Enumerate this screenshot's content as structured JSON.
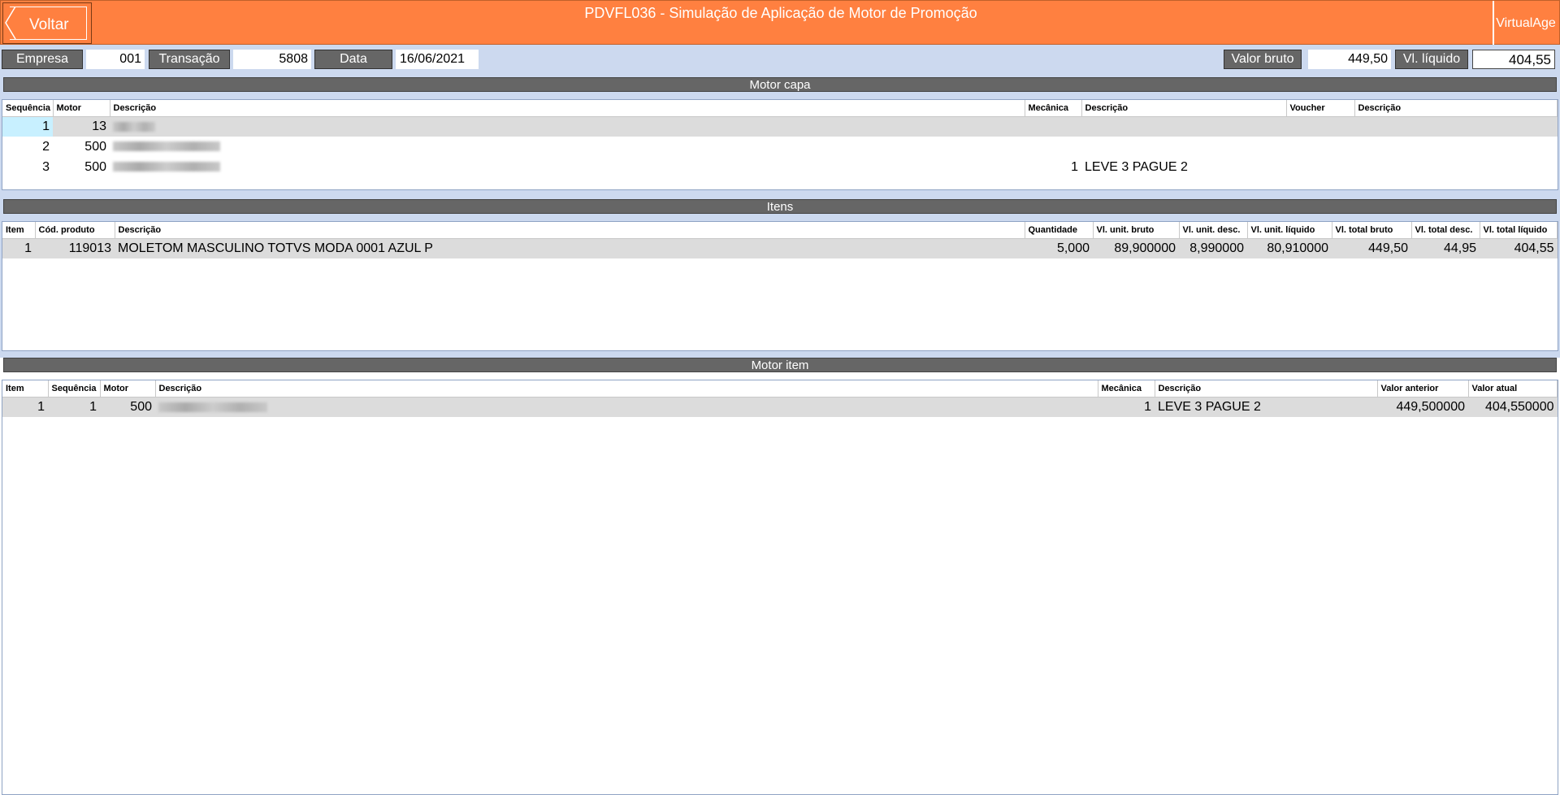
{
  "header": {
    "back_label": "Voltar",
    "title": "PDVFL036 - Simulação de Aplicação de Motor de Promoção",
    "brand": "VirtualAge"
  },
  "info": {
    "empresa_label": "Empresa",
    "empresa_value": "001",
    "transacao_label": "Transação",
    "transacao_value": "5808",
    "data_label": "Data",
    "data_value": "16/06/2021",
    "valor_bruto_label": "Valor bruto",
    "valor_bruto_value": "449,50",
    "vl_liquido_label": "Vl. líquido",
    "vl_liquido_value": "404,55"
  },
  "motor_capa": {
    "title": "Motor capa",
    "columns": [
      "Sequência",
      "Motor",
      "Descrição",
      "Mecânica",
      "Descrição",
      "Voucher",
      "Descrição"
    ],
    "rows": [
      {
        "seq": "1",
        "motor": "13",
        "mecanica": "",
        "mec_desc": "",
        "voucher": "",
        "vou_desc": ""
      },
      {
        "seq": "2",
        "motor": "500",
        "mecanica": "",
        "mec_desc": "",
        "voucher": "",
        "vou_desc": ""
      },
      {
        "seq": "3",
        "motor": "500",
        "mecanica": "1",
        "mec_desc": "LEVE 3 PAGUE 2",
        "voucher": "",
        "vou_desc": ""
      }
    ]
  },
  "itens": {
    "title": "Itens",
    "columns": [
      "Item",
      "Cód. produto",
      "Descrição",
      "Quantidade",
      "Vl. unit. bruto",
      "Vl. unit. desc.",
      "Vl. unit. líquido",
      "Vl. total bruto",
      "Vl. total desc.",
      "Vl. total líquido"
    ],
    "rows": [
      {
        "item": "1",
        "cod": "119013",
        "desc": "MOLETOM MASCULINO TOTVS MODA 0001 AZUL P",
        "qtd": "5,000",
        "unit_bruto": "89,900000",
        "unit_desc": "8,990000",
        "unit_liq": "80,910000",
        "total_bruto": "449,50",
        "total_desc": "44,95",
        "total_liq": "404,55"
      }
    ]
  },
  "motor_item": {
    "title": "Motor item",
    "columns": [
      "Item",
      "Sequência",
      "Motor",
      "Descrição",
      "Mecânica",
      "Descrição",
      "Valor anterior",
      "Valor atual"
    ],
    "rows": [
      {
        "item": "1",
        "seq": "1",
        "motor": "500",
        "mecanica": "1",
        "mec_desc": "LEVE 3 PAGUE 2",
        "anterior": "449,500000",
        "atual": "404,550000"
      }
    ]
  },
  "colors": {
    "header": "#ff8040",
    "infobar": "#ccd9ef",
    "label_bg": "#666666",
    "selected_row": "#dcdcdc",
    "current_cell": "#c8f0ff"
  }
}
